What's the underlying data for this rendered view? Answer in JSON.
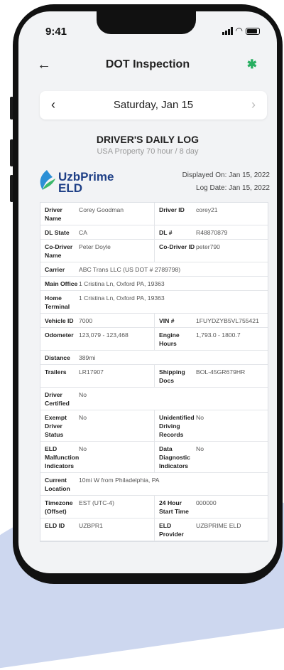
{
  "status_bar": {
    "time": "9:41"
  },
  "header": {
    "back": "←",
    "title": "DOT Inspection",
    "bluetooth": "✱"
  },
  "date_nav": {
    "prev": "‹",
    "date": "Saturday, Jan 15",
    "next": "›"
  },
  "log": {
    "title": "DRIVER'S DAILY LOG",
    "subtitle": "USA Property 70 hour / 8 day",
    "logo_line1": "UzbPrime",
    "logo_line2": "ELD",
    "displayed_on": "Displayed On: Jan 15, 2022",
    "log_date": "Log Date: Jan 15, 2022"
  },
  "colors": {
    "brand": "#1e3f86",
    "accent_green": "#27ae60",
    "bg_shape": "#cdd7ef"
  },
  "rows": [
    {
      "l1": "Driver Name",
      "v1": "Corey Goodman",
      "l2": "Driver ID",
      "v2": "corey21"
    },
    {
      "l1": "DL State",
      "v1": "CA",
      "l2": "DL #",
      "v2": "R48870879"
    },
    {
      "l1": "Co-Driver Name",
      "v1": "Peter Doyle",
      "l2": "Co-Driver ID",
      "v2": "peter790"
    },
    {
      "l1": "Carrier",
      "v1": "ABC Trans LLC (US DOT # 2789798)"
    },
    {
      "l1": "Main Office",
      "v1": "1 Cristina Ln, Oxford PA, 19363"
    },
    {
      "l1": "Home Terminal",
      "v1": "1 Cristina Ln, Oxford PA, 19363"
    },
    {
      "l1": "Vehicle ID",
      "v1": "7000",
      "l2": "VIN #",
      "v2": "1FUYDZYB5VL755421"
    },
    {
      "l1": "Odometer",
      "v1": "123,079 - 123,468",
      "l2": "Engine Hours",
      "v2": "1,793.0 - 1800.7"
    },
    {
      "l1": "Distance",
      "v1": "389mi"
    },
    {
      "l1": "Trailers",
      "v1": "LR17907",
      "l2": "Shipping Docs",
      "v2": "BOL-45GR679HR"
    },
    {
      "l1": "Driver Certified",
      "v1": "No"
    },
    {
      "l1": "Exempt Driver Status",
      "v1": "No",
      "l2": "Unidentified Driving Records",
      "v2": "No"
    },
    {
      "l1": "ELD Malfunction Indicators",
      "v1": "No",
      "l2": "Data Diagnostic Indicators",
      "v2": "No"
    },
    {
      "l1": "Current Location",
      "v1": "10mi W from Philadelphia, PA"
    },
    {
      "l1": "Timezone (Offset)",
      "v1": "EST (UTC-4)",
      "l2": "24 Hour Start Time",
      "v2": "000000"
    },
    {
      "l1": "ELD ID",
      "v1": "UZBPR1",
      "l2": "ELD Provider",
      "v2": "UZBPRIME ELD"
    }
  ]
}
